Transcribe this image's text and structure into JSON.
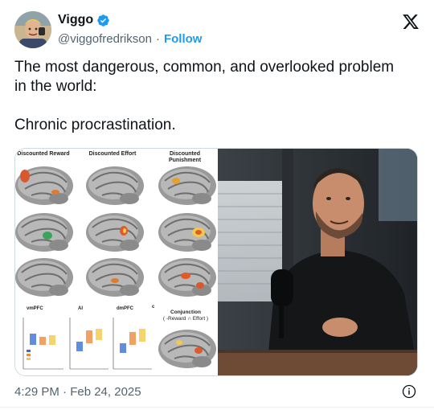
{
  "author": {
    "display_name": "Viggo",
    "handle": "@viggofredrikson",
    "separator": "·",
    "follow_label": "Follow",
    "verified": true,
    "verified_color": "#1d9bf0"
  },
  "tweet": {
    "line1": "The most dangerous, common, and overlooked problem",
    "line2": "in the world:",
    "line3": "Chronic procrastination."
  },
  "figure": {
    "col1": "Discounted Reward",
    "col2": "Discounted Effort",
    "col3": "Discounted Punishment",
    "chart1": "vmPFC",
    "chart2": "AI",
    "chart3": "dmPFC",
    "panel_c": "c",
    "conjunction_title": "Conjunction",
    "conjunction_sub": "( -Reward ∩ Effort )",
    "legend": [
      "Reward",
      "Effort",
      "Punishment"
    ],
    "legend_colors": [
      "#3a6fd8",
      "#f08a3c",
      "#f2c94c"
    ]
  },
  "footer": {
    "timestamp": "4:29 PM · Feb 24, 2025"
  },
  "icons": {
    "close": "x-logo-icon",
    "info": "info-icon"
  }
}
